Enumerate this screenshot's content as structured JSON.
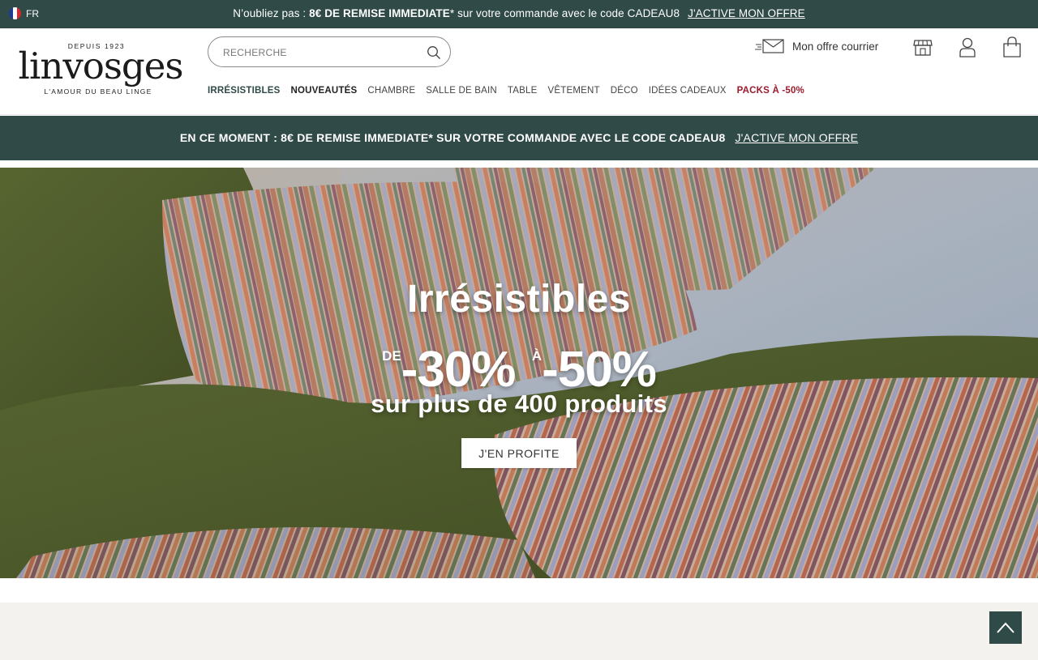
{
  "topbar": {
    "language": "FR",
    "flag_colors": [
      "#1f3a93",
      "#ffffff",
      "#d9262c"
    ],
    "msg_prefix": "N’oubliez pas : ",
    "msg_bold": "8€ DE REMISE IMMEDIATE",
    "msg_suffix": "* sur votre commande avec le code CADEAU8",
    "cta": "J'ACTIVE MON OFFRE"
  },
  "header": {
    "logo": {
      "since": "DEPUIS 1923",
      "brand": "linvosges",
      "tagline": "L'AMOUR DU BEAU LINGE"
    },
    "search": {
      "placeholder": "RECHERCHE",
      "value": ""
    },
    "mail_offer_label": "Mon offre courrier",
    "icons": [
      "mail-icon",
      "store-icon",
      "account-icon",
      "bag-icon"
    ]
  },
  "nav": {
    "items": [
      {
        "label": "IRRÉSISTIBLES",
        "style": "active"
      },
      {
        "label": "NOUVEAUTÉS",
        "style": "bold"
      },
      {
        "label": "CHAMBRE",
        "style": "normal"
      },
      {
        "label": "SALLE DE BAIN",
        "style": "normal"
      },
      {
        "label": "TABLE",
        "style": "normal"
      },
      {
        "label": "VÊTEMENT",
        "style": "normal"
      },
      {
        "label": "DÉCO",
        "style": "normal"
      },
      {
        "label": "IDÉES CADEAUX",
        "style": "normal"
      },
      {
        "label": "PACKS À -50%",
        "style": "red"
      }
    ]
  },
  "band": {
    "msg_prefix": "EN CE MOMENT : ",
    "msg_main": "8€ DE REMISE IMMEDIATE* SUR VOTRE COMMANDE AVEC LE CODE CADEAU8",
    "cta": "J'ACTIVE MON OFFRE"
  },
  "hero": {
    "title": "Irrésistibles",
    "from_word": "DE",
    "from_pct": "-30%",
    "to_word": "À",
    "to_pct": "-50%",
    "subtitle": "sur plus de 400 produits",
    "button": "J'EN PROFITE"
  },
  "colors": {
    "brand_dark_green": "#2f4a47",
    "packs_red": "#9c1a2b",
    "footer_beige": "#f3f2ee"
  }
}
